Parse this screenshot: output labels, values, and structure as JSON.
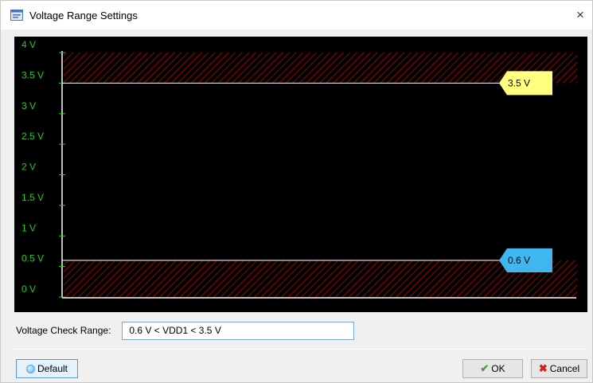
{
  "window": {
    "title": "Voltage Range Settings",
    "close_glyph": "×"
  },
  "chart_data": {
    "type": "line",
    "ylim": [
      0,
      4
    ],
    "y_tick_labels": [
      "0 V",
      "0.5 V",
      "1 V",
      "1.5 V",
      "2 V",
      "2.5 V",
      "3 V",
      "3.5 V",
      "4 V"
    ],
    "y_ticks": [
      0,
      0.5,
      1,
      1.5,
      2,
      2.5,
      3,
      3.5,
      4
    ],
    "upper_limit": {
      "value": 3.5,
      "label": "3.5 V",
      "color": "#ffff80"
    },
    "lower_limit": {
      "value": 0.6,
      "label": "0.6 V",
      "color": "#3fb6ee"
    },
    "tick_color": "#22cc22",
    "hatch_color": "#c00000",
    "grid": false
  },
  "range": {
    "label": "Voltage Check Range:",
    "value": "0.6 V < VDD1 < 3.5 V"
  },
  "buttons": {
    "default_label": "Default",
    "ok_label": "OK",
    "cancel_label": "Cancel"
  },
  "icons": {
    "app": "settings-window-icon",
    "default": "globe-icon",
    "ok": "check-icon",
    "cancel": "x-icon"
  }
}
